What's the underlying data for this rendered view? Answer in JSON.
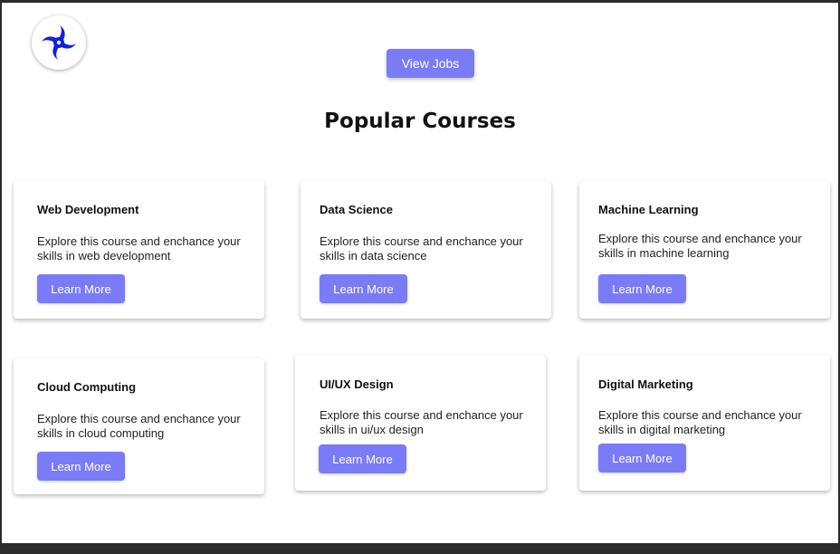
{
  "header": {
    "logo_icon": "shuriken-icon",
    "view_jobs_label": "View Jobs"
  },
  "title": "Popular Courses",
  "colors": {
    "accent": "#7a7cf7",
    "logo": "#1320e0"
  },
  "courses": [
    {
      "title": "Web Development",
      "description": "Explore this course and enchance your skills in web development",
      "button": "Learn More"
    },
    {
      "title": "Data Science",
      "description": "Explore this course and enchance your skills in data science",
      "button": "Learn More"
    },
    {
      "title": "Machine Learning",
      "description": "Explore this course and enchance your skills in machine learning",
      "button": "Learn More"
    },
    {
      "title": "Cloud Computing",
      "description": "Explore this course and enchance your skills in cloud computing",
      "button": "Learn More"
    },
    {
      "title": "UI/UX Design",
      "description": "Explore this course and enchance your skills in ui/ux design",
      "button": "Learn More"
    },
    {
      "title": "Digital Marketing",
      "description": "Explore this course and enchance your skills in digital marketing",
      "button": "Learn More"
    }
  ]
}
